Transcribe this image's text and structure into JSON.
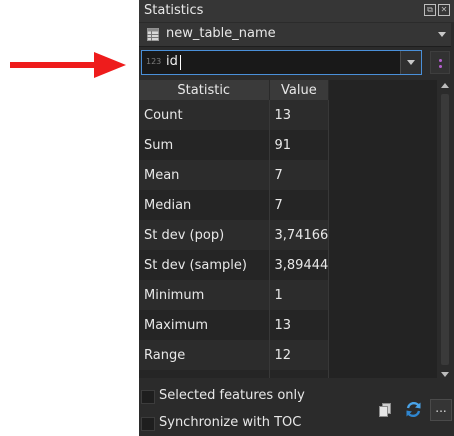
{
  "panel": {
    "title": "Statistics"
  },
  "layer": {
    "name": "new_table_name",
    "icon": "table-icon"
  },
  "field": {
    "type_badge": "123",
    "value": "id"
  },
  "table": {
    "headers": [
      "Statistic",
      "Value"
    ],
    "rows": [
      {
        "statistic": "Count",
        "value": "13"
      },
      {
        "statistic": "Sum",
        "value": "91"
      },
      {
        "statistic": "Mean",
        "value": "7"
      },
      {
        "statistic": "Median",
        "value": "7"
      },
      {
        "statistic": "St dev (pop)",
        "value": "3,74166"
      },
      {
        "statistic": "St dev (sample)",
        "value": "3,89444"
      },
      {
        "statistic": "Minimum",
        "value": "1"
      },
      {
        "statistic": "Maximum",
        "value": "13"
      },
      {
        "statistic": "Range",
        "value": "12"
      }
    ]
  },
  "options": {
    "selected_only": {
      "label": "Selected features only",
      "checked": false
    },
    "sync_toc": {
      "label": "Synchronize with TOC",
      "checked": false
    }
  },
  "toolbar": {
    "more_label": "..."
  },
  "colors": {
    "arrow": "#ee1c1c",
    "accent": "#4a90d9",
    "panel_bg": "#2b2b2b"
  }
}
